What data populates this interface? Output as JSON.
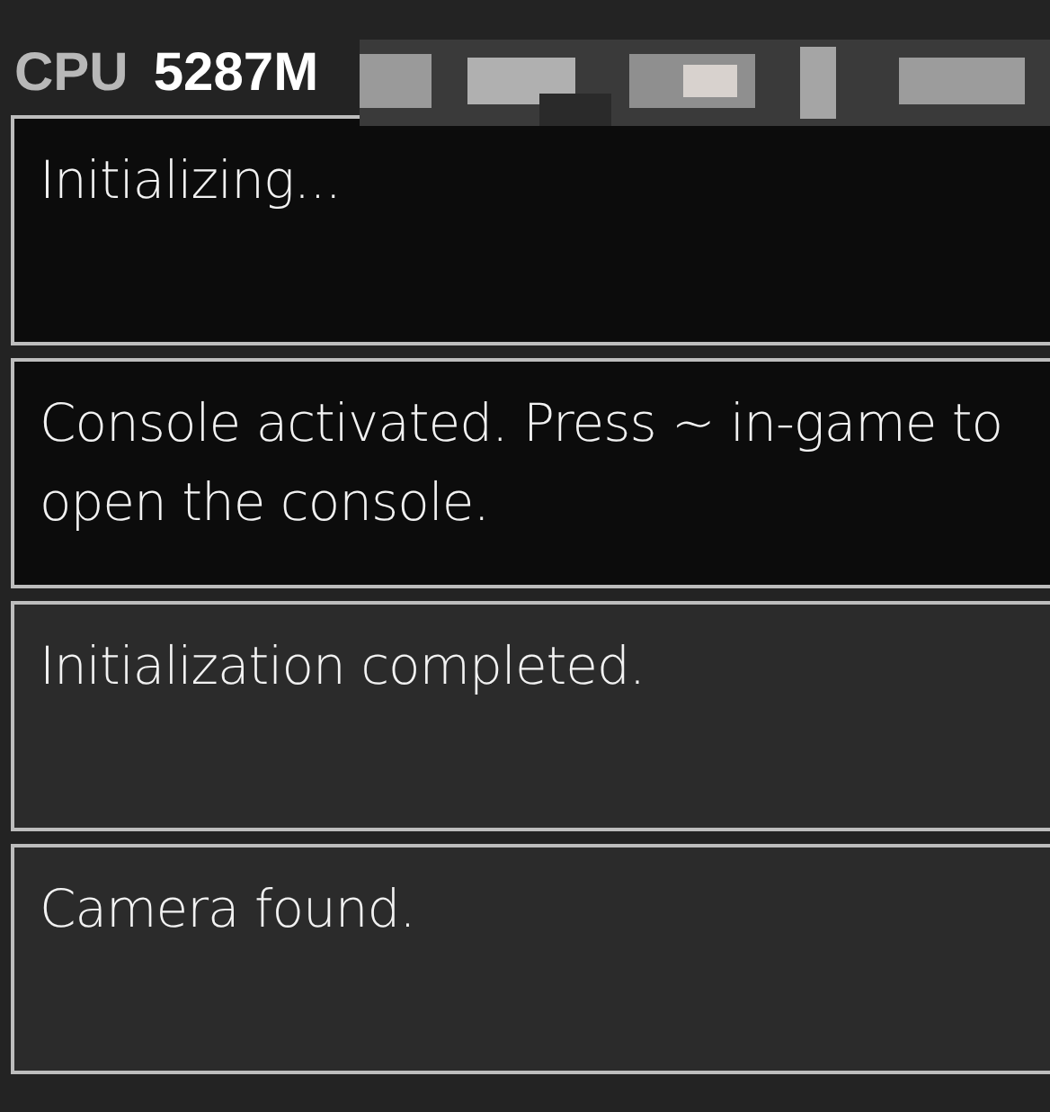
{
  "header": {
    "label": "CPU",
    "value": "5287M"
  },
  "notifications": [
    {
      "text": "Initializing..."
    },
    {
      "text": "Console activated. Press ~ in-game to open the console."
    },
    {
      "text": "Initialization completed."
    },
    {
      "text": "Camera found."
    }
  ]
}
